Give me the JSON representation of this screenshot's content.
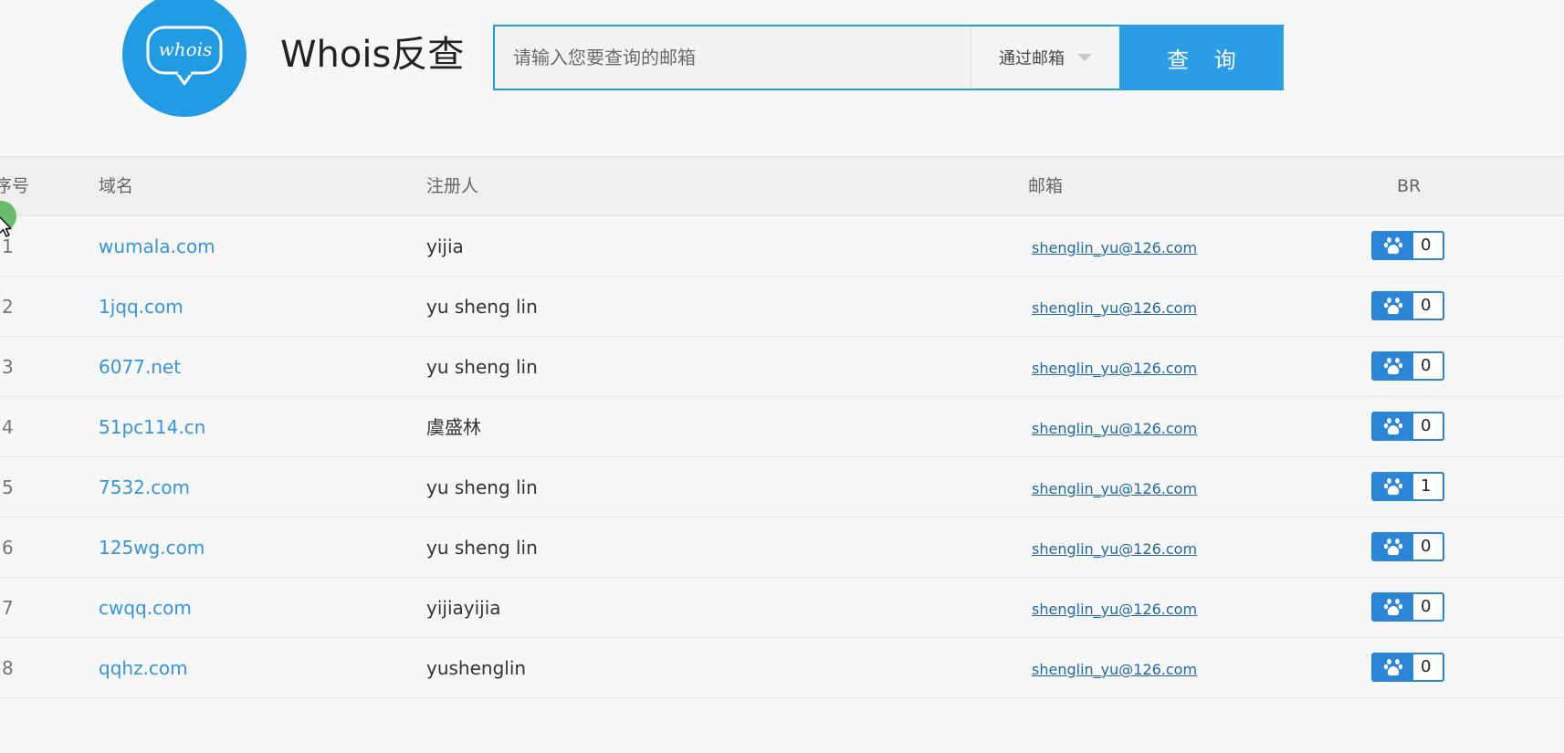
{
  "header": {
    "logo_text": "whois",
    "title": "Whois反查",
    "search_placeholder": "请输入您要查询的邮箱",
    "search_type": "通过邮箱",
    "search_button": "查 询"
  },
  "colors": {
    "accent": "#219be4",
    "link": "#3595dc",
    "badge": "#2b85d6"
  },
  "icons": {
    "logo": "speech-bubble-icon",
    "br": "baidu-paw-icon",
    "dropdown": "caret-down-icon"
  },
  "table": {
    "columns": {
      "no": "序号",
      "domain": "域名",
      "registrant": "注册人",
      "email": "邮箱",
      "br": "BR"
    },
    "rows": [
      {
        "no": "1",
        "domain": "wumala.com",
        "registrant": "yijia",
        "email": "shenglin_yu@126.com",
        "br": "0"
      },
      {
        "no": "2",
        "domain": "1jqq.com",
        "registrant": "yu sheng lin",
        "email": "shenglin_yu@126.com",
        "br": "0"
      },
      {
        "no": "3",
        "domain": "6077.net",
        "registrant": "yu sheng lin",
        "email": "shenglin_yu@126.com",
        "br": "0"
      },
      {
        "no": "4",
        "domain": "51pc114.cn",
        "registrant": "虞盛林",
        "email": "shenglin_yu@126.com",
        "br": "0"
      },
      {
        "no": "5",
        "domain": "7532.com",
        "registrant": "yu sheng lin",
        "email": "shenglin_yu@126.com",
        "br": "1"
      },
      {
        "no": "6",
        "domain": "125wg.com",
        "registrant": "yu sheng lin",
        "email": "shenglin_yu@126.com",
        "br": "0"
      },
      {
        "no": "7",
        "domain": "cwqq.com",
        "registrant": "yijiayijia",
        "email": "shenglin_yu@126.com",
        "br": "0"
      },
      {
        "no": "8",
        "domain": "qqhz.com",
        "registrant": "yushenglin",
        "email": "shenglin_yu@126.com",
        "br": "0"
      }
    ]
  }
}
